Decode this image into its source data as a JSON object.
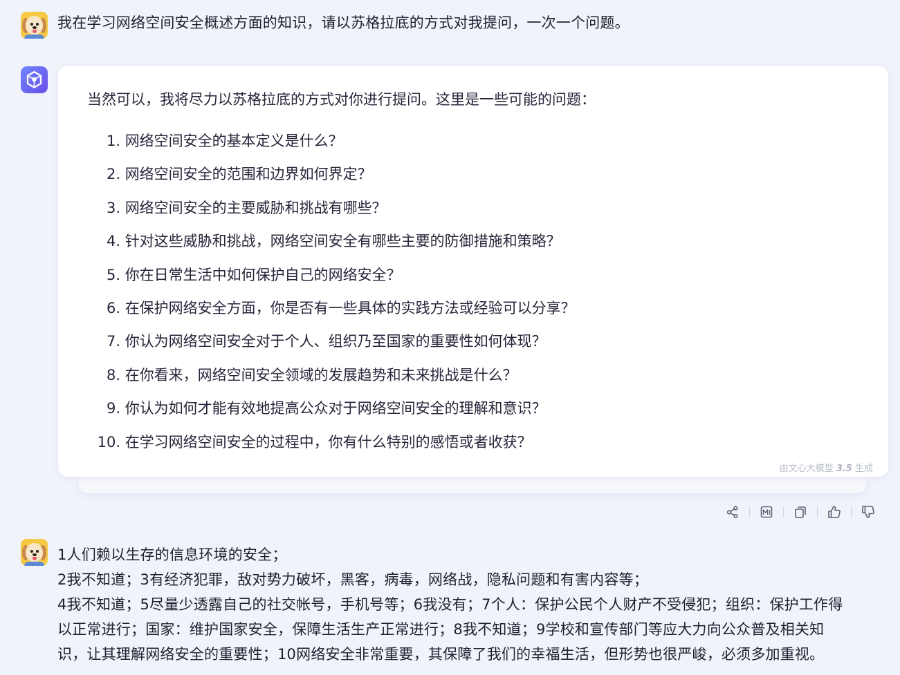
{
  "user_message_1": {
    "text": "我在学习网络空间安全概述方面的知识，请以苏格拉底的方式对我提问，一次一个问题。"
  },
  "assistant": {
    "intro": "当然可以，我将尽力以苏格拉底的方式对你进行提问。这里是一些可能的问题：",
    "questions": [
      {
        "num": "1.",
        "text": "网络空间安全的基本定义是什么？"
      },
      {
        "num": "2.",
        "text": "网络空间安全的范围和边界如何界定？"
      },
      {
        "num": "3.",
        "text": "网络空间安全的主要威胁和挑战有哪些？"
      },
      {
        "num": "4.",
        "text": "针对这些威胁和挑战，网络空间安全有哪些主要的防御措施和策略？"
      },
      {
        "num": "5.",
        "text": "你在日常生活中如何保护自己的网络安全？"
      },
      {
        "num": "6.",
        "text": "在保护网络安全方面，你是否有一些具体的实践方法或经验可以分享？"
      },
      {
        "num": "7.",
        "text": "你认为网络空间安全对于个人、组织乃至国家的重要性如何体现？"
      },
      {
        "num": "8.",
        "text": "在你看来，网络空间安全领域的发展趋势和未来挑战是什么？"
      },
      {
        "num": "9.",
        "text": "你认为如何才能有效地提高公众对于网络空间安全的理解和意识？"
      },
      {
        "num": "10.",
        "text": "在学习网络空间安全的过程中，你有什么特别的感悟或者收获？"
      }
    ],
    "watermark_prefix": "由文心大模型",
    "watermark_version": "3.5",
    "watermark_suffix": "生成"
  },
  "actions": {
    "icons": [
      "share-icon",
      "report-icon",
      "copy-icon",
      "thumbs-up-icon",
      "thumbs-down-icon"
    ]
  },
  "user_message_2": {
    "lines": [
      "1人们赖以生存的信息环境的安全；",
      "2我不知道；3有经济犯罪，敌对势力破坏，黑客，病毒，网络战，隐私问题和有害内容等；",
      "4我不知道；5尽量少透露自己的社交帐号，手机号等；6我没有；7个人：保护公民个人财产不受侵犯；组织：保护工作得",
      "以正常进行；国家：维护国家安全，保障生活生产正常进行；8我不知道；9学校和宣传部门等应大力向公众普及相关知",
      "识，让其理解网络安全的重要性；10网络安全非常重要，其保障了我们的幸福生活，但形势也很严峻，必须多加重视。"
    ]
  },
  "colors": {
    "background": "#f1f3fb",
    "card": "#ffffff",
    "bot_avatar_start": "#6f86ff",
    "bot_avatar_end": "#6a4ee8",
    "icon": "#5c6072"
  }
}
